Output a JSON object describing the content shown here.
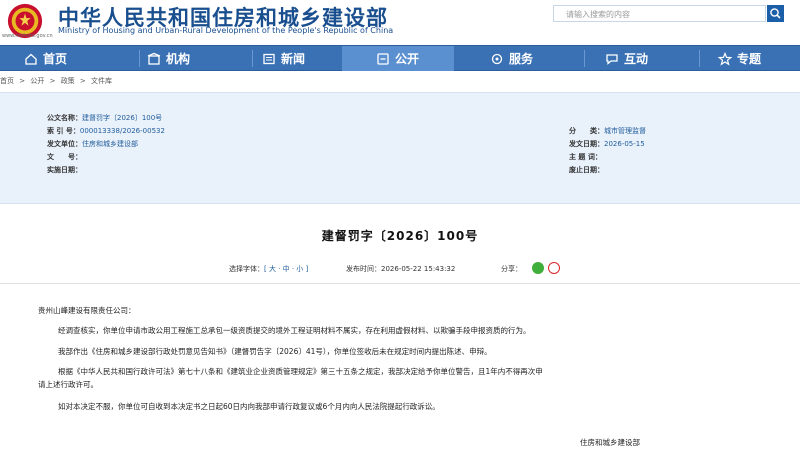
{
  "header": {
    "site_title": "中华人民共和国住房和城乡建设部",
    "site_subtitle": "Ministry of Housing and Urban-Rural Development of the People's Republic of China",
    "domain": "www.mohurd.gov.cn",
    "search_placeholder": "请输入搜索的内容"
  },
  "nav": {
    "items": [
      {
        "label": "首页",
        "icon": "home-icon"
      },
      {
        "label": "机构",
        "icon": "building-icon"
      },
      {
        "label": "新闻",
        "icon": "news-icon"
      },
      {
        "label": "公开",
        "icon": "public-icon"
      },
      {
        "label": "服务",
        "icon": "service-icon"
      },
      {
        "label": "互动",
        "icon": "interact-icon"
      },
      {
        "label": "专题",
        "icon": "topic-icon"
      }
    ],
    "active_index": 3
  },
  "breadcrumb": [
    "首页",
    ">",
    "公开",
    ">",
    "政策",
    ">",
    "文件库"
  ],
  "info": {
    "left": [
      {
        "label": "公文名称：",
        "value": "建督罚字〔2026〕100号"
      },
      {
        "label": "索 引 号：",
        "value": "000013338/2026-00532"
      },
      {
        "label": "发文单位：",
        "value": "住房和城乡建设部"
      },
      {
        "label": "文　　号：",
        "value": ""
      },
      {
        "label": "实施日期：",
        "value": ""
      }
    ],
    "right": [
      {
        "label": "分　　类：",
        "value": "城市管理监督"
      },
      {
        "label": "发文日期：",
        "value": "2026-05-15"
      },
      {
        "label": "主 题 词：",
        "value": ""
      },
      {
        "label": "废止日期：",
        "value": ""
      }
    ]
  },
  "doc": {
    "title": "建督罚字〔2026〕100号",
    "font_select_label": "选择字体：",
    "font_options": "[ 大 · 中 · 小 ]",
    "publish_time": "发布时间：2026-05-22 15:43:32",
    "share_label": "分享：",
    "paragraphs": [
      "贵州山峰建设有限责任公司：",
      "经调查核实，你单位申请市政公用工程施工总承包一级资质提交的境外工程证明材料不属实，存在利用虚假材料、以欺骗手段申报资质的行为。",
      "我部作出《住房和城乡建设部行政处罚意见告知书》（建督罚告字〔2026〕41号），你单位签收后未在规定时间内提出陈述、申辩。",
      "根据《中华人民共和国行政许可法》第七十八条和《建筑业企业资质管理规定》第三十五条之规定，我部决定给予你单位警告，且1年内不得再次申",
      "请上述行政许可。",
      "如对本决定不服，你单位可自收到本决定书之日起60日内向我部申请行政复议或6个月内向人民法院提起行政诉讼。"
    ],
    "signature": "住房和城乡建设部"
  },
  "colors": {
    "brand": "#1a4f8f",
    "nav": "#3a71b5",
    "nav_active": "#5a8fd0",
    "info_bg": "#e9f1fb",
    "link": "#1f5c9b"
  }
}
